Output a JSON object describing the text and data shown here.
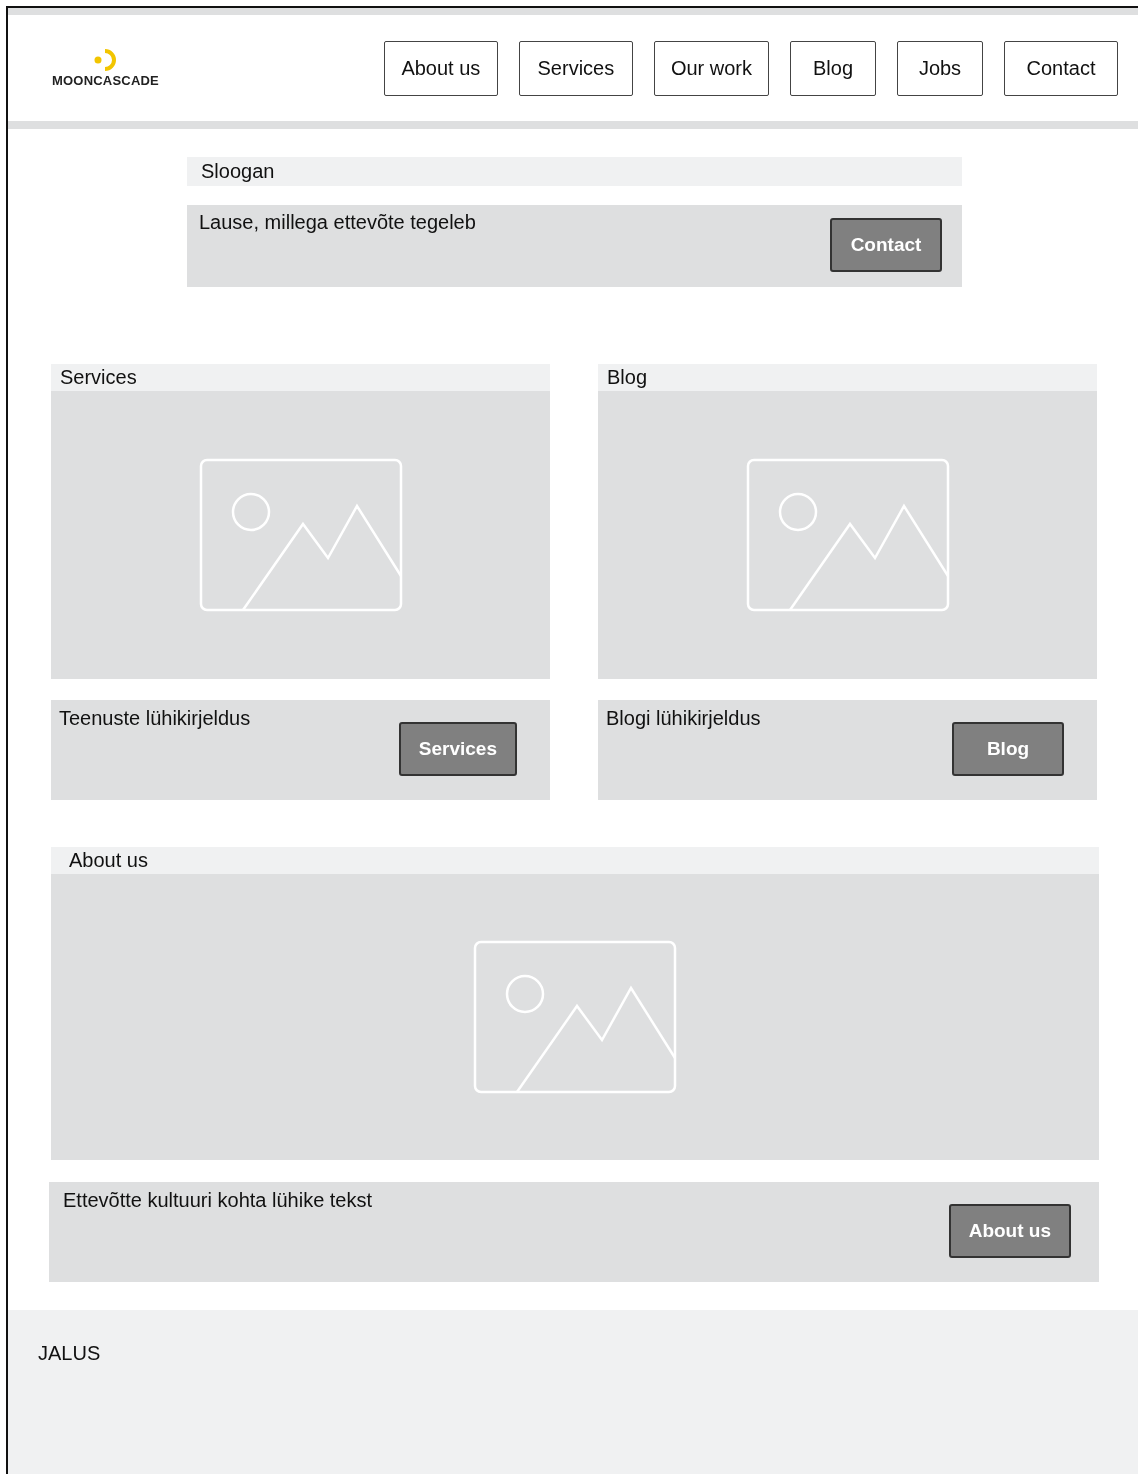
{
  "logo": {
    "text": "MOONCASCADE"
  },
  "nav": [
    {
      "label": "About us"
    },
    {
      "label": "Services"
    },
    {
      "label": "Our work"
    },
    {
      "label": "Blog"
    },
    {
      "label": "Jobs"
    },
    {
      "label": "Contact"
    }
  ],
  "hero": {
    "title": "Sloogan",
    "text": "Lause, millega ettevõte tegeleb",
    "button": "Contact"
  },
  "sections": [
    {
      "title": "Services",
      "description": "Teenuste lühikirjeldus",
      "button": "Services"
    },
    {
      "title": "Blog",
      "description": "Blogi lühikirjeldus",
      "button": "Blog"
    }
  ],
  "about": {
    "title": "About us",
    "description": "Ettevõtte kultuuri kohta lühike tekst",
    "button": "About us"
  },
  "footer": {
    "text": "JALUS"
  }
}
